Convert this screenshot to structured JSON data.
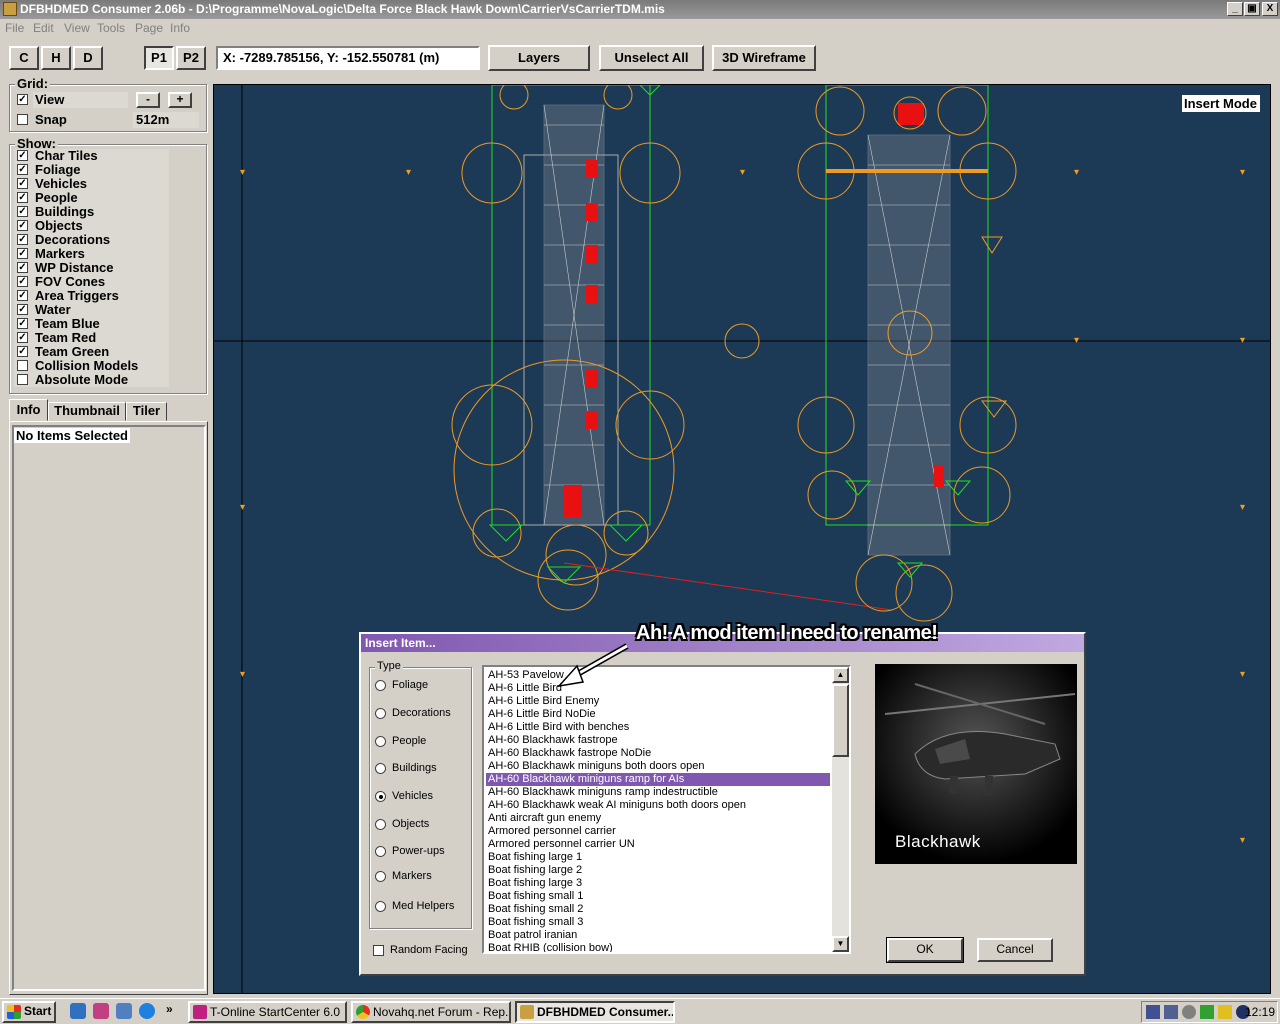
{
  "window": {
    "title": "DFBHDMED Consumer 2.06b - D:\\Programme\\NovaLogic\\Delta Force Black Hawk Down\\CarrierVsCarrierTDM.mis",
    "minimize": "_",
    "maximize": "▣",
    "close": "X"
  },
  "menu": [
    "File",
    "Edit",
    "View",
    "Tools",
    "Page",
    "Info"
  ],
  "toolbar": {
    "c": "C",
    "h": "H",
    "d": "D",
    "p1": "P1",
    "p2": "P2",
    "coords": "X: -7289.785156, Y: -152.550781 (m)",
    "layers": "Layers",
    "unselect_all": "Unselect All",
    "wireframe": "3D Wireframe"
  },
  "grid": {
    "title": "Grid:",
    "view_label": "View",
    "view_checked": true,
    "snap_label": "Snap",
    "snap_checked": false,
    "snap_value": "512m",
    "minus": "-",
    "plus": "+"
  },
  "show": {
    "title": "Show:",
    "items": [
      {
        "label": "Char Tiles",
        "checked": true
      },
      {
        "label": "Foliage",
        "checked": true
      },
      {
        "label": "Vehicles",
        "checked": true
      },
      {
        "label": "People",
        "checked": true
      },
      {
        "label": "Buildings",
        "checked": true
      },
      {
        "label": "Objects",
        "checked": true
      },
      {
        "label": "Decorations",
        "checked": true
      },
      {
        "label": "Markers",
        "checked": true
      },
      {
        "label": "WP Distance",
        "checked": true
      },
      {
        "label": "FOV Cones",
        "checked": true
      },
      {
        "label": "Area Triggers",
        "checked": true
      },
      {
        "label": "Water",
        "checked": true
      },
      {
        "label": "Team Blue",
        "checked": true
      },
      {
        "label": "Team Red",
        "checked": true
      },
      {
        "label": "Team Green",
        "checked": true
      },
      {
        "label": "Collision Models",
        "checked": false
      },
      {
        "label": "Absolute Mode",
        "checked": false
      }
    ]
  },
  "tabs": [
    "Info",
    "Thumbnail",
    "Tiler"
  ],
  "info_text": "No Items Selected",
  "canvas": {
    "mode": "Insert Mode"
  },
  "annotation": "Ah! A mod item I need to rename!",
  "dialog": {
    "title": "Insert Item...",
    "type_label": "Type",
    "types": [
      {
        "label": "Foliage",
        "selected": false
      },
      {
        "label": "Decorations",
        "selected": false
      },
      {
        "label": "People",
        "selected": false
      },
      {
        "label": "Buildings",
        "selected": false
      },
      {
        "label": "Vehicles",
        "selected": true
      },
      {
        "label": "Objects",
        "selected": false
      },
      {
        "label": "Power-ups",
        "selected": false
      },
      {
        "label": "Markers",
        "selected": false
      },
      {
        "label": "Med Helpers",
        "selected": false
      }
    ],
    "random_facing": "Random Facing",
    "items": [
      "AH-53 Pavelow",
      "AH-6 Little Bird",
      "AH-6 Little Bird Enemy",
      "AH-6 Little Bird NoDie",
      "AH-6 Little Bird with benches",
      "AH-60 Blackhawk fastrope",
      "AH-60 Blackhawk fastrope NoDie",
      "AH-60 Blackhawk miniguns both doors open",
      "AH-60 Blackhawk miniguns ramp for AIs",
      "AH-60 Blackhawk miniguns ramp indestructible",
      "AH-60 Blackhawk weak AI miniguns both doors open",
      "Anti aircraft gun enemy",
      "Armored personnel carrier",
      "Armored personnel carrier UN",
      "Boat fishing large 1",
      "Boat fishing large 2",
      "Boat fishing large 3",
      "Boat fishing small 1",
      "Boat fishing small 2",
      "Boat fishing small 3",
      "Boat patrol iranian",
      "Boat RHIB (collision bow)"
    ],
    "selected_index": 8,
    "preview_caption": "Blackhawk",
    "ok": "OK",
    "cancel": "Cancel"
  },
  "taskbar": {
    "start": "Start",
    "tasks": [
      {
        "label": "T-Online StartCenter 6.0",
        "active": false
      },
      {
        "label": "Novahq.net Forum - Rep...",
        "active": false
      },
      {
        "label": "DFBHDMED Consumer...",
        "active": true
      }
    ],
    "time": "12:19"
  }
}
